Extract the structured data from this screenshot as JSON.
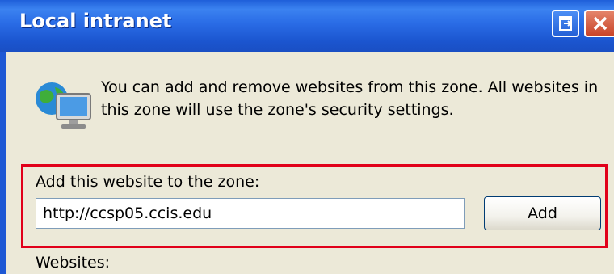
{
  "window": {
    "title": "Local intranet"
  },
  "title_buttons": {
    "help_icon": "help-icon",
    "close_icon": "close-icon"
  },
  "intro": {
    "icon": "globe-computer-icon",
    "text": "You can add and remove websites from this zone. All websites in this zone will use the zone's security settings."
  },
  "add_site": {
    "label": "Add this website to the zone:",
    "value": "http://ccsp05.ccis.edu",
    "button_label": "Add",
    "highlight_color": "#e1001a"
  },
  "websites": {
    "label": "Websites:"
  }
}
